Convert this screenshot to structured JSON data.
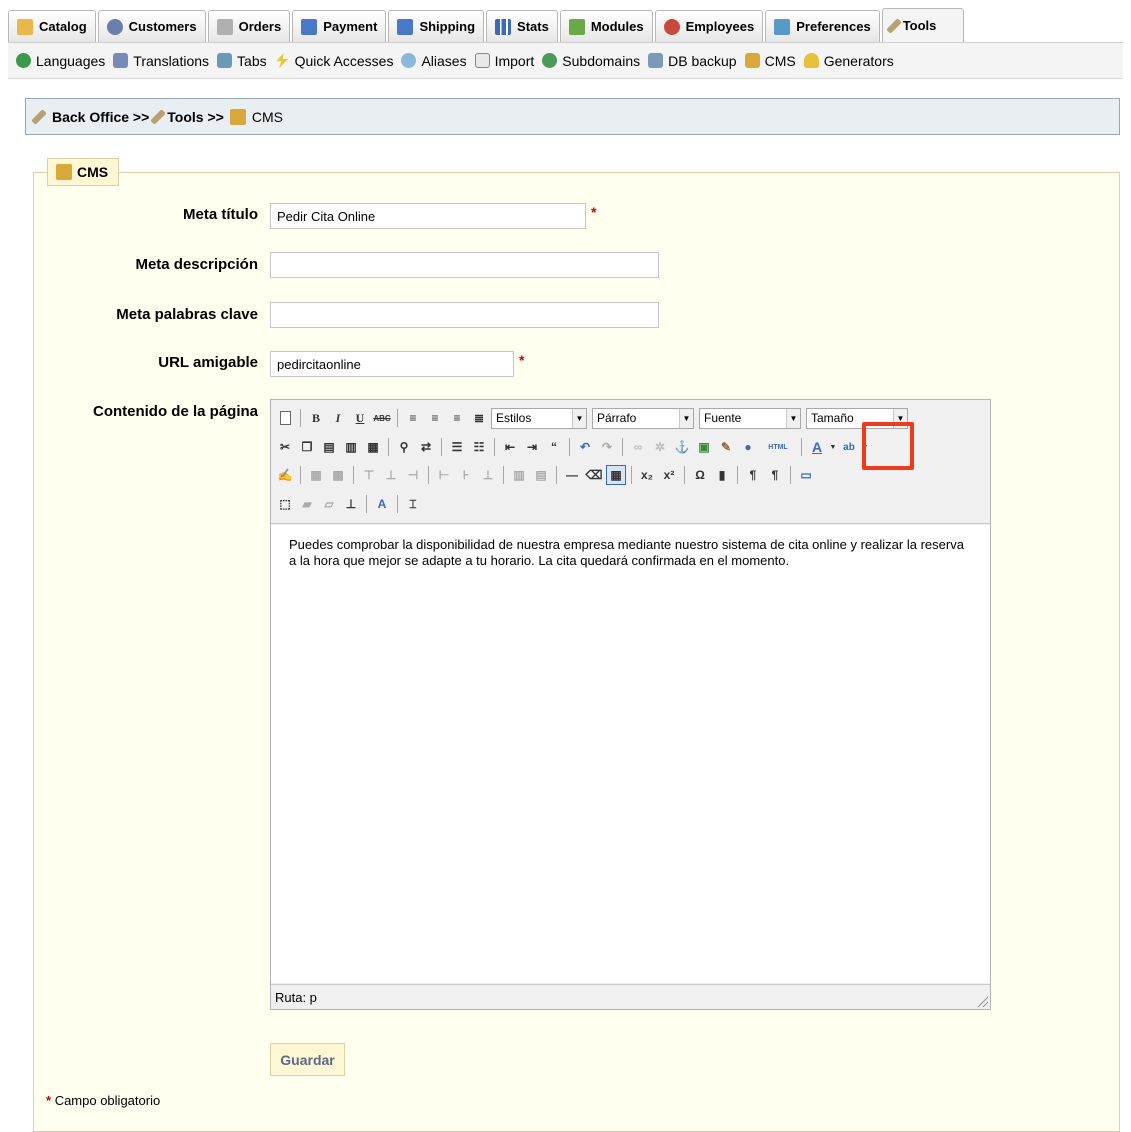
{
  "tabs": [
    {
      "label": "Catalog",
      "icon": "folder-icon",
      "color": "#e8b84a"
    },
    {
      "label": "Customers",
      "icon": "customers-icon",
      "color": "#6a7fa8"
    },
    {
      "label": "Orders",
      "icon": "orders-icon",
      "color": "#9a9a9a"
    },
    {
      "label": "Payment",
      "icon": "payment-icon",
      "color": "#4a78c8"
    },
    {
      "label": "Shipping",
      "icon": "shipping-icon",
      "color": "#4a78c8"
    },
    {
      "label": "Stats",
      "icon": "stats-icon",
      "color": "#3a6ab8"
    },
    {
      "label": "Modules",
      "icon": "modules-icon",
      "color": "#6aa84a"
    },
    {
      "label": "Employees",
      "icon": "employees-icon",
      "color": "#c84a3a"
    },
    {
      "label": "Preferences",
      "icon": "preferences-icon",
      "color": "#5a98c8"
    },
    {
      "label": "Tools",
      "icon": "tools-icon",
      "color": "#b8a070"
    }
  ],
  "subtabs": [
    {
      "label": "Languages",
      "icon": "globe-icon",
      "color": "#3a9a4a"
    },
    {
      "label": "Translations",
      "icon": "translations-icon",
      "color": "#7a8ab8"
    },
    {
      "label": "Tabs",
      "icon": "tabs-icon",
      "color": "#6a9ab8"
    },
    {
      "label": "Quick Accesses",
      "icon": "lightning-icon",
      "color": "#e8c83a"
    },
    {
      "label": "Aliases",
      "icon": "magnifier-icon",
      "color": "#8ab8d8"
    },
    {
      "label": "Import",
      "icon": "import-icon",
      "color": "#5aa84a"
    },
    {
      "label": "Subdomains",
      "icon": "subdomains-icon",
      "color": "#4a9a5a"
    },
    {
      "label": "DB backup",
      "icon": "database-icon",
      "color": "#7a9ab8"
    },
    {
      "label": "CMS",
      "icon": "cms-icon",
      "color": "#d8a83a"
    },
    {
      "label": "Generators",
      "icon": "bulb-icon",
      "color": "#e8c03a"
    }
  ],
  "breadcrumb": {
    "back_office": "Back Office >>",
    "tools": "Tools >>",
    "cms": "CMS"
  },
  "legend": "CMS",
  "form": {
    "meta_title_label": "Meta título",
    "meta_title_value": "Pedir Cita Online",
    "meta_desc_label": "Meta descripción",
    "meta_desc_value": "",
    "meta_keywords_label": "Meta palabras clave",
    "meta_keywords_value": "",
    "url_label": "URL amigable",
    "url_value": "pedircitaonline",
    "content_label": "Contenido de la página",
    "required_mark": "*"
  },
  "editor": {
    "styles": "Estilos",
    "format": "Párrafo",
    "font": "Fuente",
    "size": "Tamaño",
    "content": "Puedes comprobar la disponibilidad de nuestra empresa mediante nuestro sistema de cita online y realizar la reserva a la hora que mejor se adapte a tu horario. La cita quedará confirmada en el momento.",
    "path": "Ruta: p"
  },
  "save_label": "Guardar",
  "footnote": "Campo obligatorio",
  "colors": {
    "highlight": "#f03a1e",
    "required": "#cc0000"
  }
}
